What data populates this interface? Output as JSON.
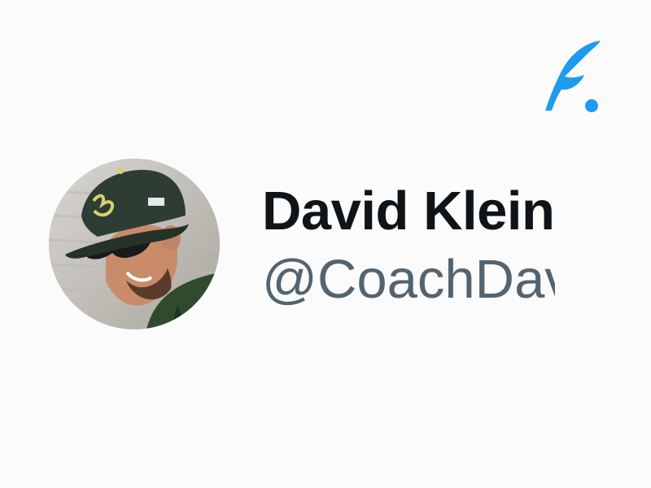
{
  "brand": {
    "logo_icon": "quill-feather-icon",
    "accent_color": "#1d9bf0"
  },
  "profile": {
    "display_name": "David Klein",
    "handle": "@CoachDav",
    "avatar_icon": "profile-photo"
  },
  "colors": {
    "background": "#fbfbfb",
    "name_text": "#0f1419",
    "handle_text": "#536471"
  }
}
